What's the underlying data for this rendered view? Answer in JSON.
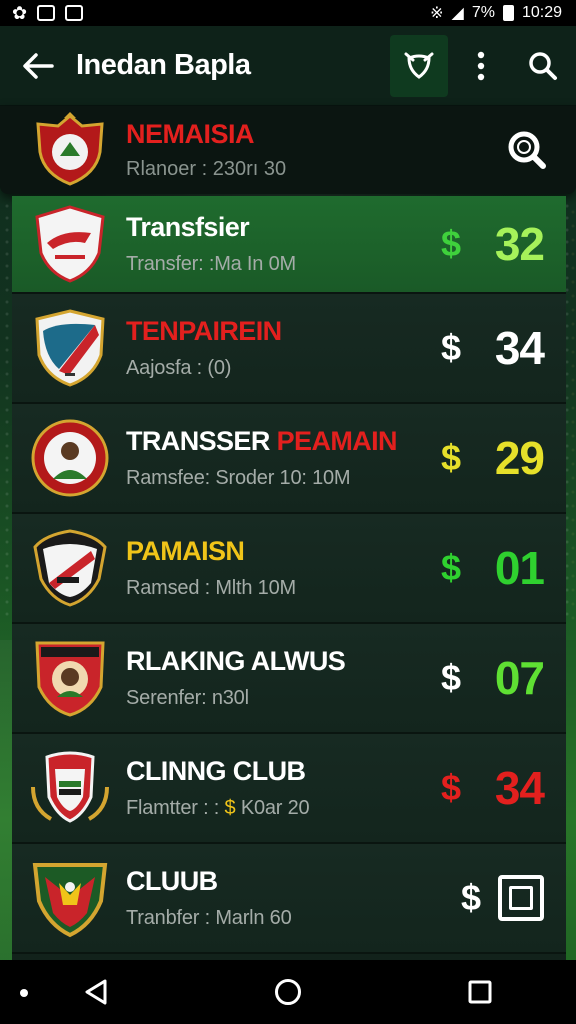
{
  "status_bar": {
    "time": "10:29",
    "battery": "7%"
  },
  "app_bar": {
    "title": "Inedan Bapla"
  },
  "header": {
    "title": "NEMAISIA",
    "subtitle": "Rlanoer : 230rı 30"
  },
  "rows": [
    {
      "title": "Transfsier",
      "title_accent": "",
      "subtitle": "Transfer: :Ma In 0M",
      "subtitle_gold": "",
      "subtitle_after": "",
      "dollar": "$",
      "dollar_color": "#3fd13c",
      "value": "32",
      "value_color": "#a6f25a",
      "highlight": true
    },
    {
      "title": "",
      "title_accent": "TENPAIREIN",
      "subtitle": "Aajosfa : (0)",
      "subtitle_gold": "",
      "subtitle_after": "",
      "dollar": "$",
      "dollar_color": "#ffffff",
      "value": "34",
      "value_color": "#ffffff",
      "highlight": false
    },
    {
      "title": "TRANSSER ",
      "title_accent": "PEAMAIN",
      "subtitle": "Ramsfee: Sroder 10: 10M",
      "subtitle_gold": "",
      "subtitle_after": "",
      "dollar": "$",
      "dollar_color": "#e6e02a",
      "value": "29",
      "value_color": "#e6e02a",
      "highlight": false
    },
    {
      "title": "PAMAISN",
      "title_accent": "",
      "subtitle": "Ramsed : Mlth 10M",
      "subtitle_gold": "",
      "subtitle_after": "",
      "dollar": "$",
      "dollar_color": "#2fd12f",
      "value": "01",
      "value_color": "#2fd12f",
      "highlight": false
    },
    {
      "title": "RLAKING ALWUS",
      "title_accent": "",
      "subtitle": "Serenfer: n30l",
      "subtitle_gold": "",
      "subtitle_after": "",
      "dollar": "$",
      "dollar_color": "#ffffff",
      "value": "07",
      "value_color": "#5fe033",
      "highlight": false
    },
    {
      "title": "CLINNG CLUB",
      "title_accent": "",
      "subtitle": "Flamtter : : ",
      "subtitle_gold": "$",
      "subtitle_after": " K0ar 20",
      "dollar": "$",
      "dollar_color": "#e3201e",
      "value": "34",
      "value_color": "#e3201e",
      "highlight": false
    },
    {
      "title": "CLUUB",
      "title_accent": "",
      "subtitle": "Tranbfer : Marln 60",
      "subtitle_gold": "",
      "subtitle_after": "",
      "dollar": "$",
      "dollar_color": "#ffffff",
      "value": "",
      "value_color": "#ffffff",
      "highlight": false
    }
  ],
  "icons": {
    "back": "arrow-left-icon",
    "badge_action": "shield-badge-icon",
    "more": "more-vertical-icon",
    "search": "search-icon",
    "header_search": "search-icon",
    "last_row": "square-icon",
    "nav_back": "triangle-back-icon",
    "nav_home": "circle-home-icon",
    "nav_recents": "square-recents-icon"
  },
  "colors": {
    "accent_red": "#e3201e",
    "accent_green": "#1f6b2e",
    "gold": "#f0c419"
  }
}
